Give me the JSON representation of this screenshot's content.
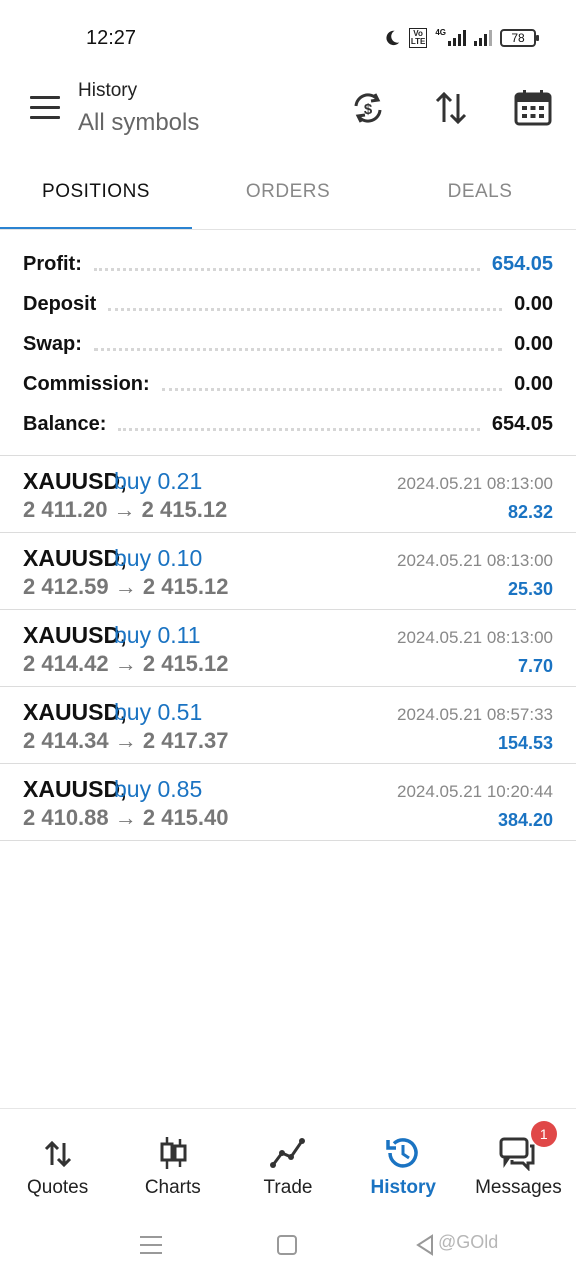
{
  "status_bar": {
    "time": "12:27",
    "volte": "Vo\nLTE",
    "network": "4G",
    "battery": "78"
  },
  "app_bar": {
    "title": "History",
    "subtitle": "All symbols",
    "icons": [
      "menu-icon",
      "currency-sync-icon",
      "sort-icon",
      "calendar-icon"
    ]
  },
  "tabs": [
    {
      "label": "POSITIONS",
      "active": true
    },
    {
      "label": "ORDERS",
      "active": false
    },
    {
      "label": "DEALS",
      "active": false
    }
  ],
  "summary": {
    "profit": {
      "label": "Profit:",
      "value": "654.05"
    },
    "deposit": {
      "label": "Deposit",
      "value": "0.00"
    },
    "swap": {
      "label": "Swap:",
      "value": "0.00"
    },
    "commission": {
      "label": "Commission:",
      "value": "0.00"
    },
    "balance": {
      "label": "Balance:",
      "value": "654.05"
    }
  },
  "positions": [
    {
      "symbol": "XAUUSD,",
      "side": "buy 0.21",
      "prices": "2 411.20 → 2 415.12",
      "time": "2024.05.21 08:13:00",
      "profit": "82.32"
    },
    {
      "symbol": "XAUUSD,",
      "side": "buy 0.10",
      "prices": "2 412.59 → 2 415.12",
      "time": "2024.05.21 08:13:00",
      "profit": "25.30"
    },
    {
      "symbol": "XAUUSD,",
      "side": "buy 0.11",
      "prices": "2 414.42 → 2 415.12",
      "time": "2024.05.21 08:13:00",
      "profit": "7.70"
    },
    {
      "symbol": "XAUUSD,",
      "side": "buy 0.51",
      "prices": "2 414.34 → 2 417.37",
      "time": "2024.05.21 08:57:33",
      "profit": "154.53"
    },
    {
      "symbol": "XAUUSD,",
      "side": "buy 0.85",
      "prices": "2 410.88 → 2 415.40",
      "time": "2024.05.21 10:20:44",
      "profit": "384.20"
    }
  ],
  "bottom_nav": {
    "quotes": "Quotes",
    "charts": "Charts",
    "trade": "Trade",
    "history": "History",
    "messages": "Messages",
    "messages_badge": "1"
  },
  "watermark": "@GOld",
  "colors": {
    "accent": "#2a83d1",
    "value_blue": "#1a73c2",
    "badge_red": "#e04848"
  }
}
